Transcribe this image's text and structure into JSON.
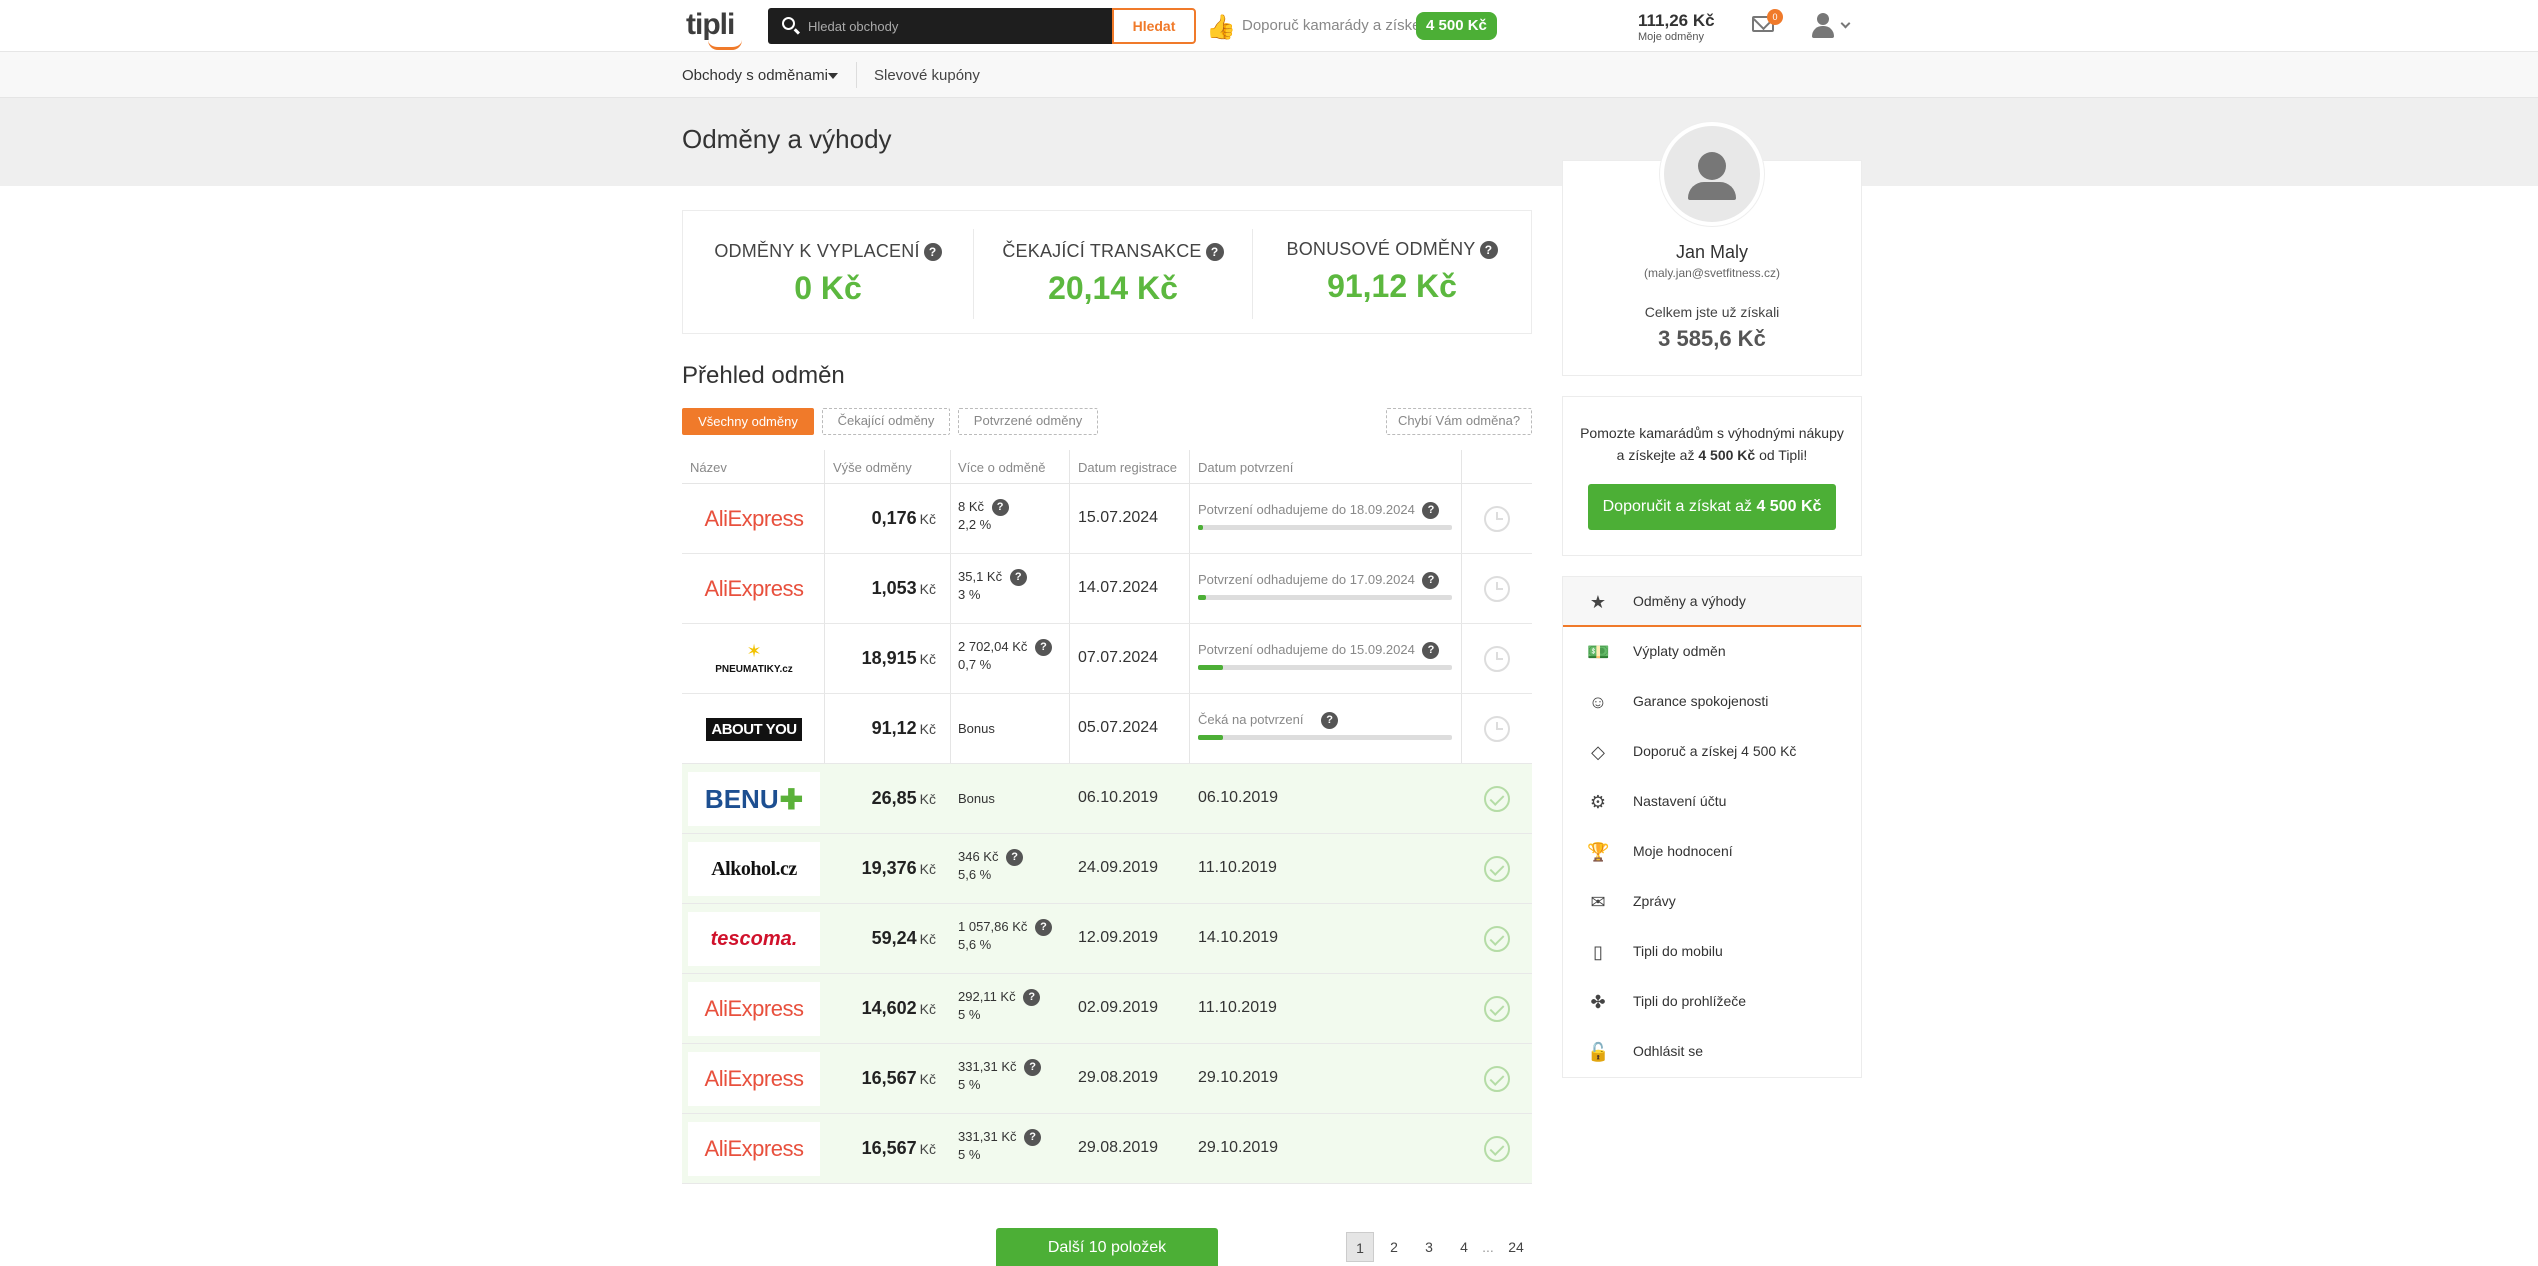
{
  "header": {
    "logo": "tipli",
    "search_placeholder": "Hledat obchody",
    "search_button": "Hledat",
    "recommend_text": "Doporuč kamarády a získej",
    "recommend_badge": "4 500 Kč",
    "balance_value": "111,26 Kč",
    "balance_label": "Moje odměny",
    "mail_count": "0"
  },
  "subnav": {
    "stores": "Obchody s odměnami",
    "coupons": "Slevové kupóny"
  },
  "page_title": "Odměny a výhody",
  "stats": [
    {
      "label": "ODMĚNY K VYPLACENÍ",
      "value": "0 Kč"
    },
    {
      "label": "ČEKAJÍCÍ TRANSAKCE",
      "value": "20,14 Kč"
    },
    {
      "label": "BONUSOVÉ ODMĚNY",
      "value": "91,12 Kč"
    }
  ],
  "overview": {
    "title": "Přehled odměn",
    "filters": [
      "Všechny odměny",
      "Čekající odměny",
      "Potvrzené odměny"
    ],
    "missing": "Chybí Vám odměna?"
  },
  "table": {
    "columns": [
      "Název",
      "Výše odměny",
      "Více o odměně",
      "Datum registrace",
      "Datum potvrzení"
    ],
    "currency": "Kč",
    "rows": [
      {
        "store": "AliExpress",
        "amount": "0,176",
        "more1": "8 Kč",
        "more2": "2,2 %",
        "reg": "15.07.2024",
        "confirm": "Potvrzení odhadujeme do 18.09.2024",
        "progress": 0.02,
        "status": "pending"
      },
      {
        "store": "AliExpress",
        "amount": "1,053",
        "more1": "35,1 Kč",
        "more2": "3 %",
        "reg": "14.07.2024",
        "confirm": "Potvrzení odhadujeme do 17.09.2024",
        "progress": 0.03,
        "status": "pending"
      },
      {
        "store": "PNEUMATIKY.cz",
        "amount": "18,915",
        "more1": "2 702,04 Kč",
        "more2": "0,7 %",
        "reg": "07.07.2024",
        "confirm": "Potvrzení odhadujeme do 15.09.2024",
        "progress": 0.1,
        "status": "pending"
      },
      {
        "store": "ABOUT YOU",
        "amount": "91,12",
        "more1": "Bonus",
        "more2": "",
        "reg": "05.07.2024",
        "confirm": "Čeká na potvrzení",
        "progress": 0.1,
        "status": "pending"
      },
      {
        "store": "BENU",
        "amount": "26,85",
        "more1": "Bonus",
        "more2": "",
        "reg": "06.10.2019",
        "confirm": "06.10.2019",
        "status": "confirmed"
      },
      {
        "store": "Alkohol.cz",
        "amount": "19,376",
        "more1": "346 Kč",
        "more2": "5,6 %",
        "reg": "24.09.2019",
        "confirm": "11.10.2019",
        "status": "confirmed"
      },
      {
        "store": "tescoma.",
        "amount": "59,24",
        "more1": "1 057,86 Kč",
        "more2": "5,6 %",
        "reg": "12.09.2019",
        "confirm": "14.10.2019",
        "status": "confirmed"
      },
      {
        "store": "AliExpress",
        "amount": "14,602",
        "more1": "292,11 Kč",
        "more2": "5 %",
        "reg": "02.09.2019",
        "confirm": "11.10.2019",
        "status": "confirmed"
      },
      {
        "store": "AliExpress",
        "amount": "16,567",
        "more1": "331,31 Kč",
        "more2": "5 %",
        "reg": "29.08.2019",
        "confirm": "29.10.2019",
        "status": "confirmed"
      },
      {
        "store": "AliExpress",
        "amount": "16,567",
        "more1": "331,31 Kč",
        "more2": "5 %",
        "reg": "29.08.2019",
        "confirm": "29.10.2019",
        "status": "confirmed"
      }
    ]
  },
  "load_more": "Další 10 položek",
  "pagination": [
    "1",
    "2",
    "3",
    "4",
    "...",
    "24"
  ],
  "profile": {
    "name": "Jan Maly",
    "email": "(maly.jan@svetfitness.cz)",
    "total_label": "Celkem jste už získali",
    "total_value": "3 585,6 Kč"
  },
  "promo": {
    "text_a": "Pomozte kamarádům s výhodnými nákupy a získejte až ",
    "text_bold": "4 500 Kč",
    "text_b": " od Tipli!",
    "button_a": "Doporučit a získat až ",
    "button_bold": "4 500 Kč"
  },
  "menu": [
    {
      "label": "Odměny a výhody",
      "icon": "star-icon"
    },
    {
      "label": "Výplaty odměn",
      "icon": "banknote-icon"
    },
    {
      "label": "Garance spokojenosti",
      "icon": "smile-icon"
    },
    {
      "label": "Doporuč a získej 4 500 Kč",
      "icon": "diamond-icon"
    },
    {
      "label": "Nastavení účtu",
      "icon": "gear-icon"
    },
    {
      "label": "Moje hodnocení",
      "icon": "trophy-icon"
    },
    {
      "label": "Zprávy",
      "icon": "envelope-icon"
    },
    {
      "label": "Tipli do mobilu",
      "icon": "mobile-icon"
    },
    {
      "label": "Tipli do prohlížeče",
      "icon": "puzzle-icon"
    },
    {
      "label": "Odhlásit se",
      "icon": "unlock-icon"
    }
  ],
  "colors": {
    "accent": "#f07a2a",
    "green": "#4caf36",
    "value_green": "#5cb83f"
  }
}
